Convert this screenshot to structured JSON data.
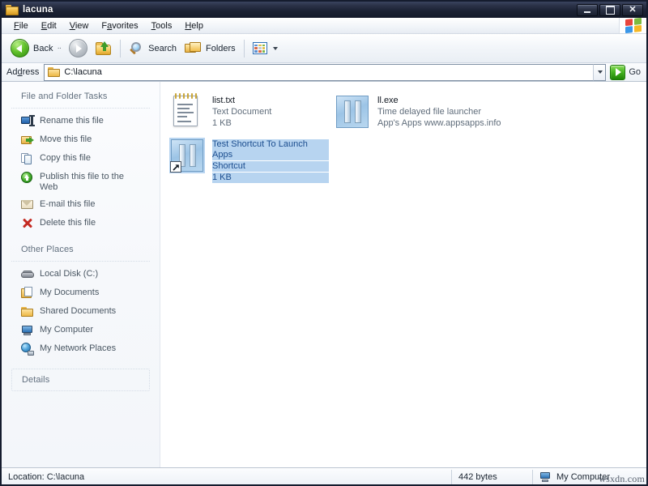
{
  "window": {
    "title": "lacuna",
    "title_icon": "folder-icon",
    "controls": {
      "minimize": "–",
      "maximize": "□",
      "close": "✕"
    }
  },
  "menubar": {
    "items": [
      {
        "label": "File",
        "accel": "F"
      },
      {
        "label": "Edit",
        "accel": "E"
      },
      {
        "label": "View",
        "accel": "V"
      },
      {
        "label": "Favorites",
        "accel": "a"
      },
      {
        "label": "Tools",
        "accel": "T"
      },
      {
        "label": "Help",
        "accel": "H"
      }
    ],
    "brand_icon": "windows-flag-icon"
  },
  "toolbar": {
    "back_label": "Back",
    "back_icon": "back-arrow-icon",
    "back_dropdown": "··",
    "forward_icon": "forward-arrow-icon",
    "up_icon": "up-folder-icon",
    "search_label": "Search",
    "search_icon": "search-icon",
    "folders_label": "Folders",
    "folders_icon": "folders-icon",
    "views_icon": "views-icon",
    "views_caret": "chevron-down-icon"
  },
  "addressbar": {
    "label": "Address",
    "accel": "d",
    "path": "C:\\lacuna",
    "folder_icon": "folder-icon",
    "dropdown_icon": "chevron-down-icon",
    "go_label": "Go",
    "go_icon": "green-arrow-icon"
  },
  "sidebar": {
    "tasks_panel": {
      "header": "File and Folder Tasks",
      "items": [
        {
          "label": "Rename this file",
          "icon": "rename-icon"
        },
        {
          "label": "Move this file",
          "icon": "move-icon"
        },
        {
          "label": "Copy this file",
          "icon": "copy-icon"
        },
        {
          "label": "Publish this file to the Web",
          "icon": "publish-web-icon"
        },
        {
          "label": "E-mail this file",
          "icon": "email-icon"
        },
        {
          "label": "Delete this file",
          "icon": "delete-icon"
        }
      ]
    },
    "other_places_panel": {
      "header": "Other Places",
      "items": [
        {
          "label": "Local Disk (C:)",
          "icon": "hard-disk-icon"
        },
        {
          "label": "My Documents",
          "icon": "my-documents-icon"
        },
        {
          "label": "Shared Documents",
          "icon": "shared-folder-icon"
        },
        {
          "label": "My Computer",
          "icon": "my-computer-icon"
        },
        {
          "label": "My Network Places",
          "icon": "network-places-icon"
        }
      ]
    },
    "details_panel": {
      "header": "Details"
    }
  },
  "files": [
    {
      "name": "list.txt",
      "type": "Text Document",
      "size": "1 KB",
      "icon": "text-document-icon",
      "selected": false,
      "col": 0,
      "row": 0
    },
    {
      "name": "Test Shortcut To Launch Apps",
      "type": "Shortcut",
      "size": "1 KB",
      "icon": "shortcut-exe-icon",
      "selected": true,
      "col": 0,
      "row": 1
    },
    {
      "name": "ll.exe",
      "type": "Time delayed file launcher",
      "size": "App's Apps  www.appsapps.info",
      "icon": "exe-icon",
      "selected": false,
      "col": 1,
      "row": 0
    }
  ],
  "statusbar": {
    "location": "Location: C:\\lacuna",
    "size": "442 bytes",
    "zone": "My Computer",
    "zone_icon": "my-computer-icon",
    "watermark": "wsxdn.com"
  },
  "colors": {
    "titlebar": "#2a3147",
    "selection": "#b7d4f0",
    "selection_text": "#1c4e8f",
    "accent_green": "#46b421",
    "sidebar_bg": "#f6f8fb"
  }
}
